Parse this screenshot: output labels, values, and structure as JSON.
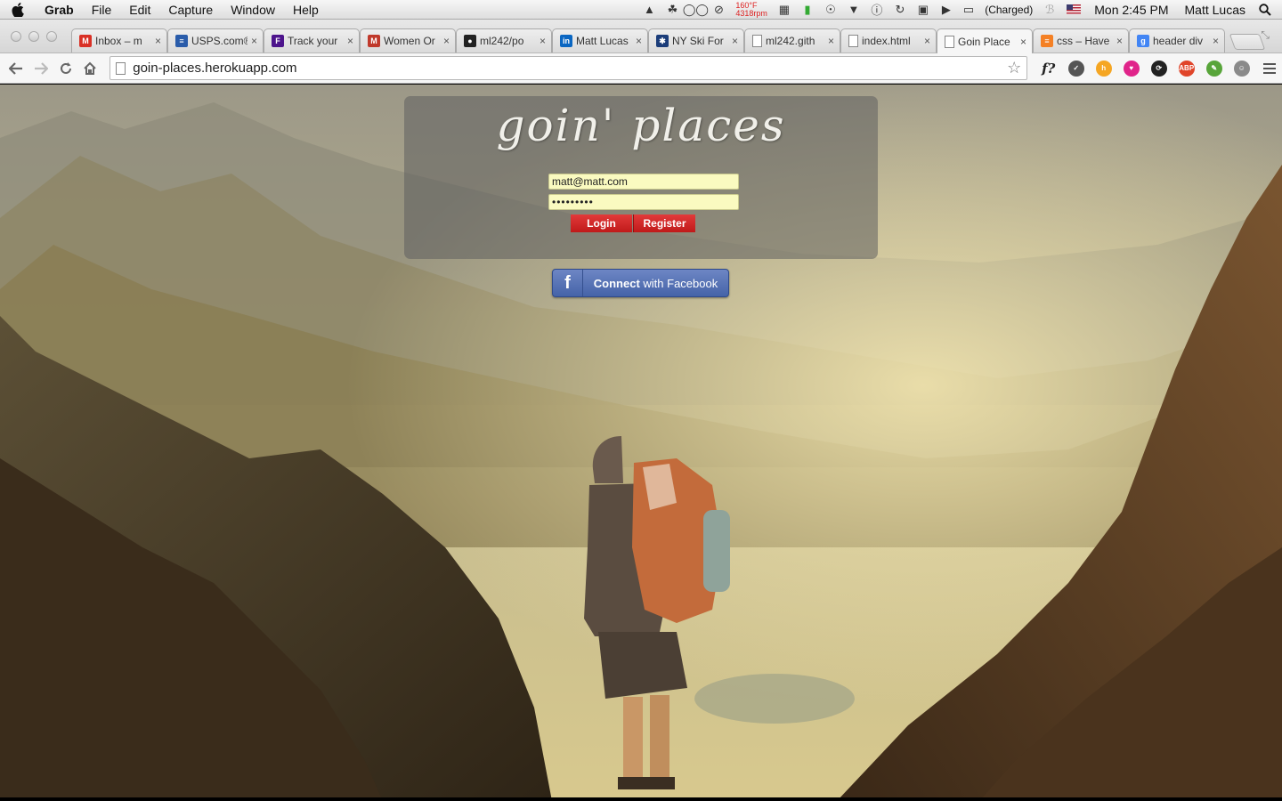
{
  "menubar": {
    "app_name": "Grab",
    "items": [
      "File",
      "Edit",
      "Capture",
      "Window",
      "Help"
    ],
    "temperature": "160°F",
    "fan_speed": "4318rpm",
    "battery_status": "(Charged)",
    "clock": "Mon 2:45 PM",
    "user": "Matt Lucas"
  },
  "tabs": [
    {
      "title": "Inbox – m",
      "favicon": "gmail-icon",
      "color": "#d93025",
      "glyph": "M"
    },
    {
      "title": "USPS.com®",
      "favicon": "usps-icon",
      "color": "#2a5caa",
      "glyph": "≡"
    },
    {
      "title": "Track your",
      "favicon": "fedex-icon",
      "color": "#4d148c",
      "glyph": "F"
    },
    {
      "title": "Women Or",
      "favicon": "mad-icon",
      "color": "#c0392b",
      "glyph": "M"
    },
    {
      "title": "ml242/po",
      "favicon": "github-icon",
      "color": "#222222",
      "glyph": "●"
    },
    {
      "title": "Matt Lucas",
      "favicon": "linkedin-icon",
      "color": "#0a66c2",
      "glyph": "in"
    },
    {
      "title": "NY Ski For",
      "favicon": "snowflake-icon",
      "color": "#1b3d7a",
      "glyph": "✱"
    },
    {
      "title": "ml242.gith",
      "favicon": "page-icon",
      "color": "#ffffff",
      "glyph": ""
    },
    {
      "title": "index.html",
      "favicon": "page-icon",
      "color": "#ffffff",
      "glyph": ""
    },
    {
      "title": "Goin Place",
      "favicon": "page-icon",
      "color": "#ffffff",
      "glyph": "",
      "active": true
    },
    {
      "title": "css – Have",
      "favicon": "stackoverflow-icon",
      "color": "#f48024",
      "glyph": "≡"
    },
    {
      "title": "header div",
      "favicon": "google-icon",
      "color": "#4285f4",
      "glyph": "g"
    }
  ],
  "toolbar": {
    "url": "goin-places.herokuapp.com"
  },
  "extensions": [
    {
      "name": "fquestion-extension-icon",
      "glyph": "f?",
      "color": "#222222"
    },
    {
      "name": "pocket-extension-icon",
      "glyph": "✓",
      "color": "#555555"
    },
    {
      "name": "honey-extension-icon",
      "glyph": "h",
      "color": "#f5a623"
    },
    {
      "name": "pink-extension-icon",
      "glyph": "♥",
      "color": "#e0248a"
    },
    {
      "name": "sync-extension-icon",
      "glyph": "⟳",
      "color": "#222222"
    },
    {
      "name": "adblock-extension-icon",
      "glyph": "ABP",
      "color": "#e0452a"
    },
    {
      "name": "evernote-extension-icon",
      "glyph": "✎",
      "color": "#58a53a"
    },
    {
      "name": "ghostery-extension-icon",
      "glyph": "☺",
      "color": "#8a8a8a"
    }
  ],
  "login": {
    "brand": "goin' places",
    "email_value": "matt@matt.com",
    "password_value": "•••••••••",
    "login_label": "Login",
    "register_label": "Register",
    "facebook_label_prefix": "Connect",
    "facebook_label_suffix": " with Facebook",
    "facebook_logo": "f"
  },
  "colors": {
    "button_red": "#d42a2a",
    "facebook_blue": "#4f6aae",
    "field_yellow": "#fafac0",
    "panel_overlay": "rgba(95,95,95,0.55)"
  }
}
